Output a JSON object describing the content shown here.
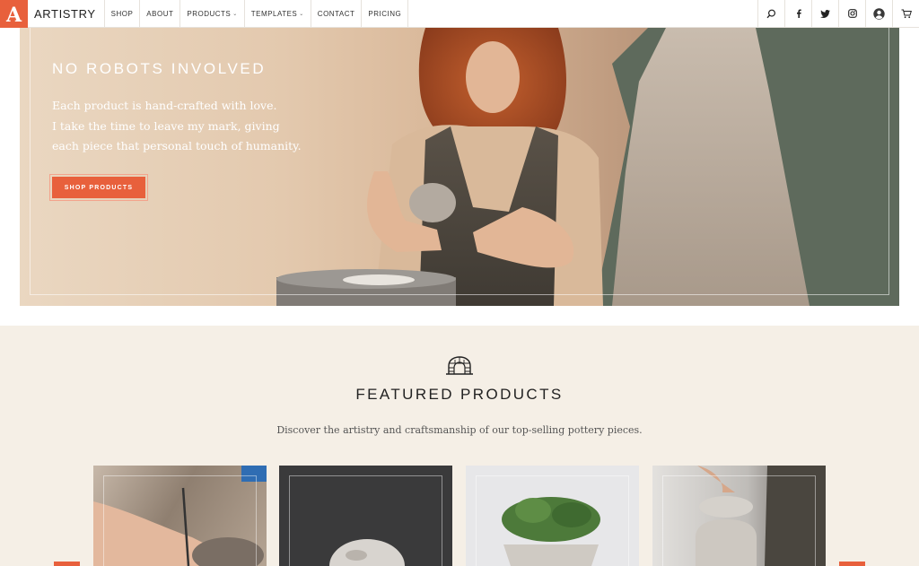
{
  "brand": {
    "mark": "A",
    "name": "ARTISTRY"
  },
  "nav": {
    "links": [
      "SHOP",
      "ABOUT",
      "PRODUCTS",
      "TEMPLATES",
      "CONTACT",
      "PRICING"
    ],
    "icons": [
      "search-icon",
      "facebook-icon",
      "twitter-icon",
      "instagram-icon",
      "account-icon",
      "cart-icon"
    ]
  },
  "hero": {
    "title": "NO ROBOTS INVOLVED",
    "copy": [
      "Each product is hand-crafted with love.",
      "I take the time to leave my mark, giving",
      "each piece that personal touch of humanity."
    ],
    "button": "SHOP PRODUCTS"
  },
  "featured": {
    "title": "FEATURED PRODUCTS",
    "subtitle": "Discover the artistry and craftsmanship of our top-selling pottery pieces.",
    "icon": "kiln-icon",
    "products": [
      "carving-pottery-photo",
      "speckled-bowl-photo",
      "moss-planter-photo",
      "lidded-jar-photo"
    ]
  },
  "colors": {
    "accent": "#e8603c",
    "section_bg": "#f5efe6"
  }
}
